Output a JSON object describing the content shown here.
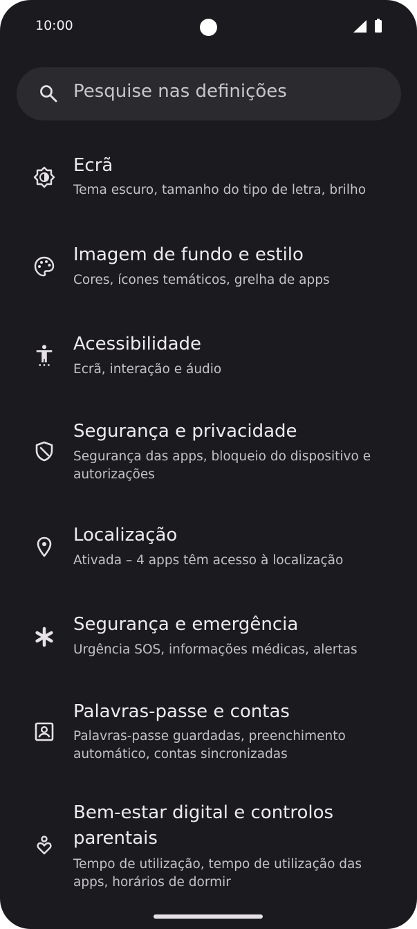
{
  "status_bar": {
    "time": "10:00"
  },
  "search": {
    "placeholder": "Pesquise nas definições"
  },
  "settings_items": [
    {
      "title": "Ecrã",
      "subtitle": "Tema escuro, tamanho do tipo de letra, brilho",
      "icon": "brightness-icon"
    },
    {
      "title": "Imagem de fundo e estilo",
      "subtitle": "Cores, ícones temáticos, grelha de apps",
      "icon": "palette-icon"
    },
    {
      "title": "Acessibilidade",
      "subtitle": "Ecrã, interação e áudio",
      "icon": "accessibility-icon"
    },
    {
      "title": "Segurança e privacidade",
      "subtitle_line1": "Segurança das apps, bloqueio do dispositivo e",
      "subtitle_line2": "autorizações",
      "icon": "shield-icon"
    },
    {
      "title": "Localização",
      "subtitle": "Ativada – 4 apps têm acesso à localização",
      "icon": "location-pin-icon"
    },
    {
      "title": "Segurança e emergência",
      "subtitle": "Urgência SOS, informações médicas, alertas",
      "icon": "asterisk-icon"
    },
    {
      "title": "Palavras-passe e contas",
      "subtitle_line1": "Palavras-passe guardadas, preenchimento",
      "subtitle_line2": "automático, contas sincronizadas",
      "icon": "account-box-icon"
    },
    {
      "title_line1": "Bem-estar digital e controlos",
      "title_line2": "parentais",
      "subtitle_line1": "Tempo de utilização, tempo de utilização das",
      "subtitle_line2": "apps, horários de dormir",
      "icon": "wellbeing-icon"
    }
  ],
  "colors": {
    "background": "#1b1b1f",
    "search_bg": "#2a2a2f",
    "text_primary": "#eeeaf0",
    "text_secondary": "#c4c1c7"
  }
}
